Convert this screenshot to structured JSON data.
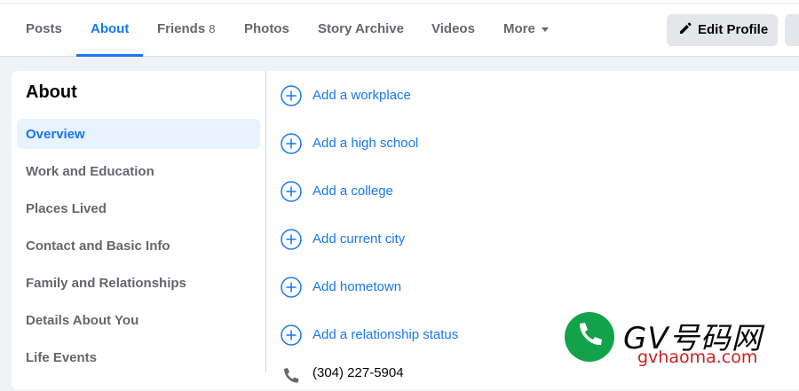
{
  "tabs": [
    {
      "label": "Posts"
    },
    {
      "label": "About"
    },
    {
      "label": "Friends",
      "count": "8"
    },
    {
      "label": "Photos"
    },
    {
      "label": "Story Archive"
    },
    {
      "label": "Videos"
    },
    {
      "label": "More"
    }
  ],
  "actions": {
    "edit_profile": "Edit Profile"
  },
  "sidebar": {
    "title": "About",
    "items": [
      {
        "label": "Overview"
      },
      {
        "label": "Work and Education"
      },
      {
        "label": "Places Lived"
      },
      {
        "label": "Contact and Basic Info"
      },
      {
        "label": "Family and Relationships"
      },
      {
        "label": "Details About You"
      },
      {
        "label": "Life Events"
      }
    ]
  },
  "overview": {
    "add_items": [
      {
        "label": "Add a workplace"
      },
      {
        "label": "Add a high school"
      },
      {
        "label": "Add a college"
      },
      {
        "label": "Add current city"
      },
      {
        "label": "Add hometown"
      },
      {
        "label": "Add a relationship status"
      }
    ],
    "phone": "(304) 227-5904"
  },
  "watermark": {
    "top": "GV号码网",
    "bottom": "gvhaoma.com"
  },
  "colors": {
    "accent": "#1877f2",
    "nav_active_bg": "#e7f3ff",
    "muted_text": "#65676b",
    "page_bg": "#f0f2f5"
  }
}
